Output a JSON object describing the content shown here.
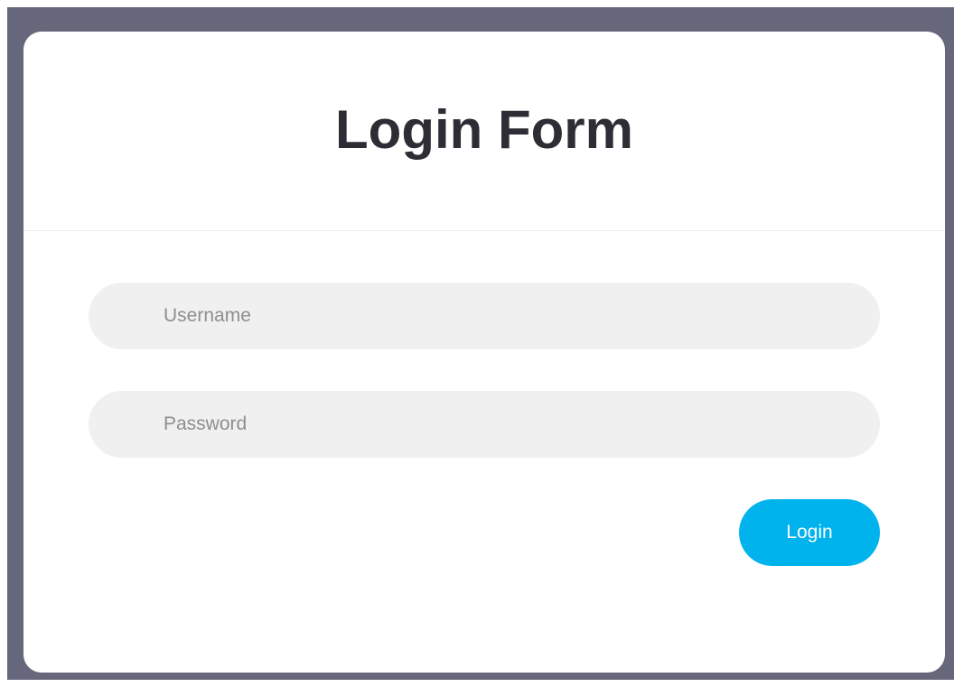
{
  "form": {
    "title": "Login Form",
    "username_placeholder": "Username",
    "password_placeholder": "Password",
    "login_label": "Login"
  },
  "colors": {
    "frame_background": "#67677c",
    "card_background": "#ffffff",
    "input_background": "#f0f0f0",
    "accent": "#00b3ec",
    "title_text": "#2d2d35"
  }
}
